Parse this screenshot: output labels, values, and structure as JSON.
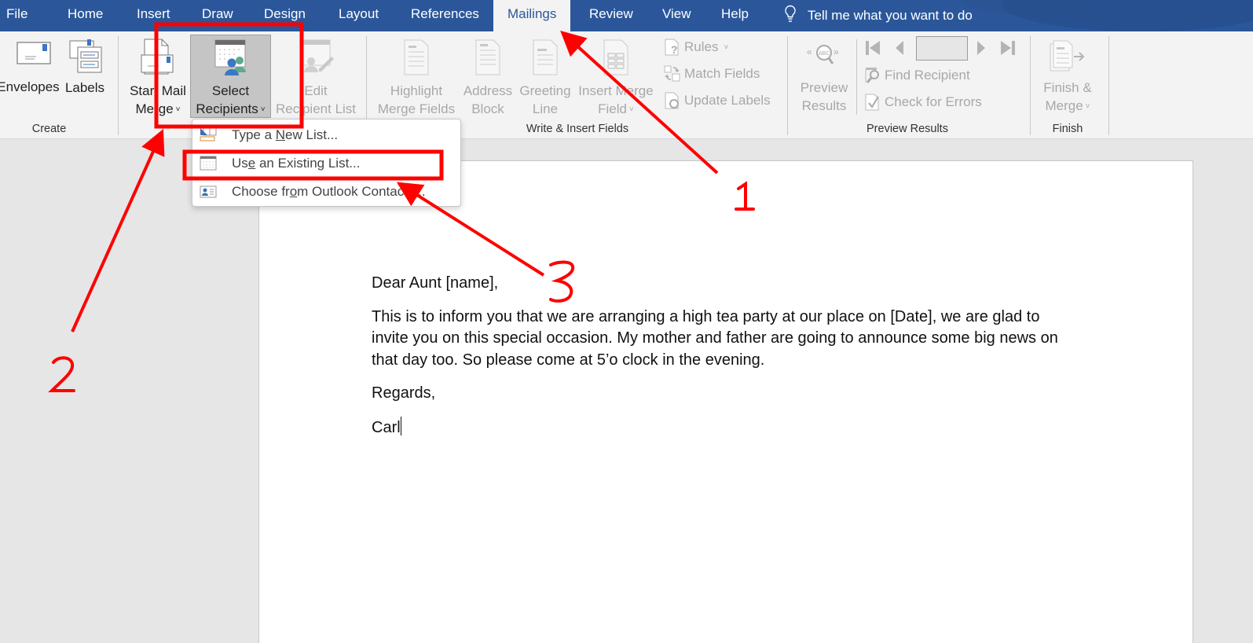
{
  "tabs": [
    {
      "label": "File",
      "active": false
    },
    {
      "label": "Home",
      "active": false
    },
    {
      "label": "Insert",
      "active": false
    },
    {
      "label": "Draw",
      "active": false
    },
    {
      "label": "Design",
      "active": false
    },
    {
      "label": "Layout",
      "active": false
    },
    {
      "label": "References",
      "active": false
    },
    {
      "label": "Mailings",
      "active": true
    },
    {
      "label": "Review",
      "active": false
    },
    {
      "label": "View",
      "active": false
    },
    {
      "label": "Help",
      "active": false
    }
  ],
  "tell_me": {
    "icon": "lightbulb-icon",
    "placeholder": "Tell me what you want to do"
  },
  "ribbon": {
    "create": {
      "label": "Create",
      "envelopes": "Envelopes",
      "labels": "Labels"
    },
    "start_mail_merge": {
      "start_mail_merge_line1": "Start Mail",
      "start_mail_merge_line2": "Merge",
      "select_recipients_line1": "Select",
      "select_recipients_line2": "Recipients",
      "edit_recipient_line1": "Edit",
      "edit_recipient_line2": "Recipient List"
    },
    "write_insert": {
      "label": "Write & Insert Fields",
      "highlight_line1": "Highlight",
      "highlight_line2": "Merge Fields",
      "address_line1": "Address",
      "address_line2": "Block",
      "greeting_line1": "Greeting",
      "greeting_line2": "Line",
      "insert_merge_line1": "Insert Merge",
      "insert_merge_line2": "Field",
      "rules": "Rules",
      "match_fields": "Match Fields",
      "update_labels": "Update Labels"
    },
    "preview": {
      "label": "Preview Results",
      "preview_line1": "Preview",
      "preview_line2": "Results",
      "record_value": "",
      "find_recipient": "Find Recipient",
      "check_errors": "Check for Errors"
    },
    "finish": {
      "label": "Finish",
      "finish_line1": "Finish &",
      "finish_line2": "Merge"
    }
  },
  "dropdown": {
    "items": [
      {
        "pre": "Type a ",
        "accel": "N",
        "post": "ew List...",
        "icon": "new-list-icon"
      },
      {
        "pre": "Us",
        "accel": "e",
        "post": " an Existing List...",
        "icon": "existing-list-icon"
      },
      {
        "pre": "Choose fr",
        "accel": "o",
        "post": "m Outlook Contacts...",
        "icon": "outlook-contacts-icon"
      }
    ]
  },
  "document": {
    "greeting": "Dear Aunt [name],",
    "body": "This is to inform you that we are arranging a high tea party at our place on [Date], we are glad to invite you on this special occasion. My mother and father are going to announce some big news on that day too. So please come at 5’o clock in the evening.",
    "closing": "Regards,",
    "signature": "Carl"
  },
  "annotations": {
    "color": "#ff0000",
    "labels": [
      "1",
      "2",
      "3"
    ]
  }
}
